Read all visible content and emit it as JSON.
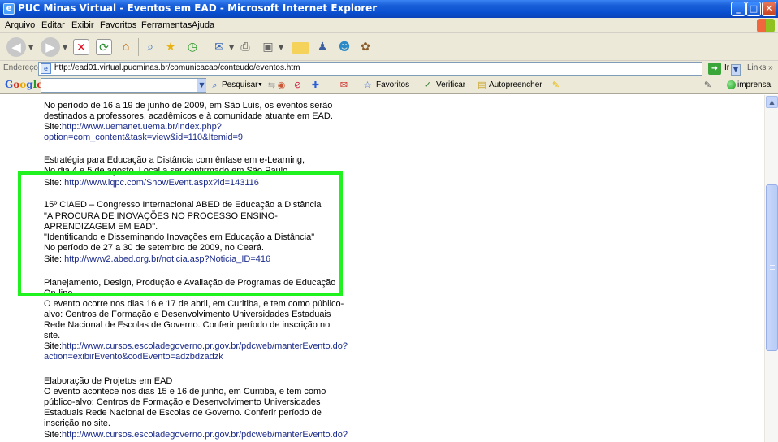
{
  "window": {
    "title": "PUC Minas Virtual - Eventos em EAD - Microsoft Internet Explorer",
    "app_icon": "ie-page-icon",
    "controls": [
      "minimize-icon",
      "maximize-icon",
      "close-icon"
    ]
  },
  "menu": {
    "items": [
      "Arquivo",
      "Editar",
      "Exibir",
      "Favoritos",
      "Ferramentas",
      "Ajuda"
    ]
  },
  "toolbar": {
    "icons": [
      "back-icon",
      "forward-icon",
      "stop-icon",
      "refresh-icon",
      "home-icon",
      "search-icon",
      "favorites-icon",
      "history-icon",
      "mail-icon",
      "print-icon",
      "edit-icon",
      "folder-icon",
      "messenger-icon",
      "research-icon",
      "misc-icon"
    ]
  },
  "address": {
    "label": "Endereço",
    "url": "http://ead01.virtual.pucminas.br/comunicacao/conteudo/eventos.htm",
    "go_label": "Ir",
    "links_label": "Links »"
  },
  "google": {
    "logo": "Google",
    "search_value": "",
    "pesquisar": "Pesquisar",
    "favoritos": "Favoritos",
    "verificar": "Verificar",
    "autopreencher": "Autopreencher",
    "imprensa": "imprensa"
  },
  "content": {
    "lines": [
      {
        "text": "No período de 16 a 19 de junho de 2009, em São Luís, os eventos serão"
      },
      {
        "text": "destinados a professores, acadêmicos e à comunidade atuante em EAD."
      },
      {
        "prefix": "Site:",
        "link": "http://www.uemanet.uema.br/index.php?"
      },
      {
        "link": "option=com_content&task=view&id=110&Itemid=9"
      },
      {
        "text": "Estratégia para Educação a Distância com ênfase em e-Learning,"
      },
      {
        "text": "No dia 4 e 5 de agosto. Local a ser confirmado em São Paulo."
      },
      {
        "prefix": "Site: ",
        "link": "http://www.iqpc.com/ShowEvent.aspx?id=143116"
      },
      {
        "text": "15º CIAED – Congresso Internacional ABED de Educação a Distância"
      },
      {
        "text": "\"A PROCURA DE INOVAÇÕES NO PROCESSO ENSINO-"
      },
      {
        "text": "APRENDIZAGEM EM EAD\"."
      },
      {
        "text": "\"Identificando e Disseminando Inovações em Educação a Distância\""
      },
      {
        "text": "No período de 27 a 30 de setembro de 2009, no Ceará."
      },
      {
        "prefix": "Site: ",
        "link": "http://www2.abed.org.br/noticia.asp?Noticia_ID=416"
      },
      {
        "text": "Planejamento, Design, Produção e Avaliação de Programas de Educação"
      },
      {
        "text": "On-line"
      },
      {
        "text": "O evento ocorre nos dias 16 e 17 de abril, em Curitiba, e tem como público-"
      },
      {
        "text": "alvo: Centros de Formação e Desenvolvimento Universidades Estaduais"
      },
      {
        "text": "Rede Nacional de Escolas de Governo. Conferir período de inscrição no"
      },
      {
        "text": "site."
      },
      {
        "prefix": "Site:",
        "link": "http://www.cursos.escoladegoverno.pr.gov.br/pdcweb/manterEvento.do?"
      },
      {
        "link": "action=exibirEvento&codEvento=adzbdzadzk"
      },
      {
        "text": "Elaboração de Projetos em EAD"
      },
      {
        "text": "O evento acontece nos dias 15 e 16 de junho, em Curitiba, e tem como"
      },
      {
        "text": "público-alvo: Centros de Formação e Desenvolvimento Universidades"
      },
      {
        "text": "Estaduais Rede Nacional de Escolas de Governo. Conferir período de"
      },
      {
        "text": "inscrição no site."
      },
      {
        "prefix": "Site:",
        "link": "http://www.cursos.escoladegoverno.pr.gov.br/pdcweb/manterEvento.do?"
      }
    ]
  },
  "colors": {
    "highlight": "#1ff21f",
    "link": "#1a2a8a",
    "titlebar": "#0a4fd0"
  }
}
